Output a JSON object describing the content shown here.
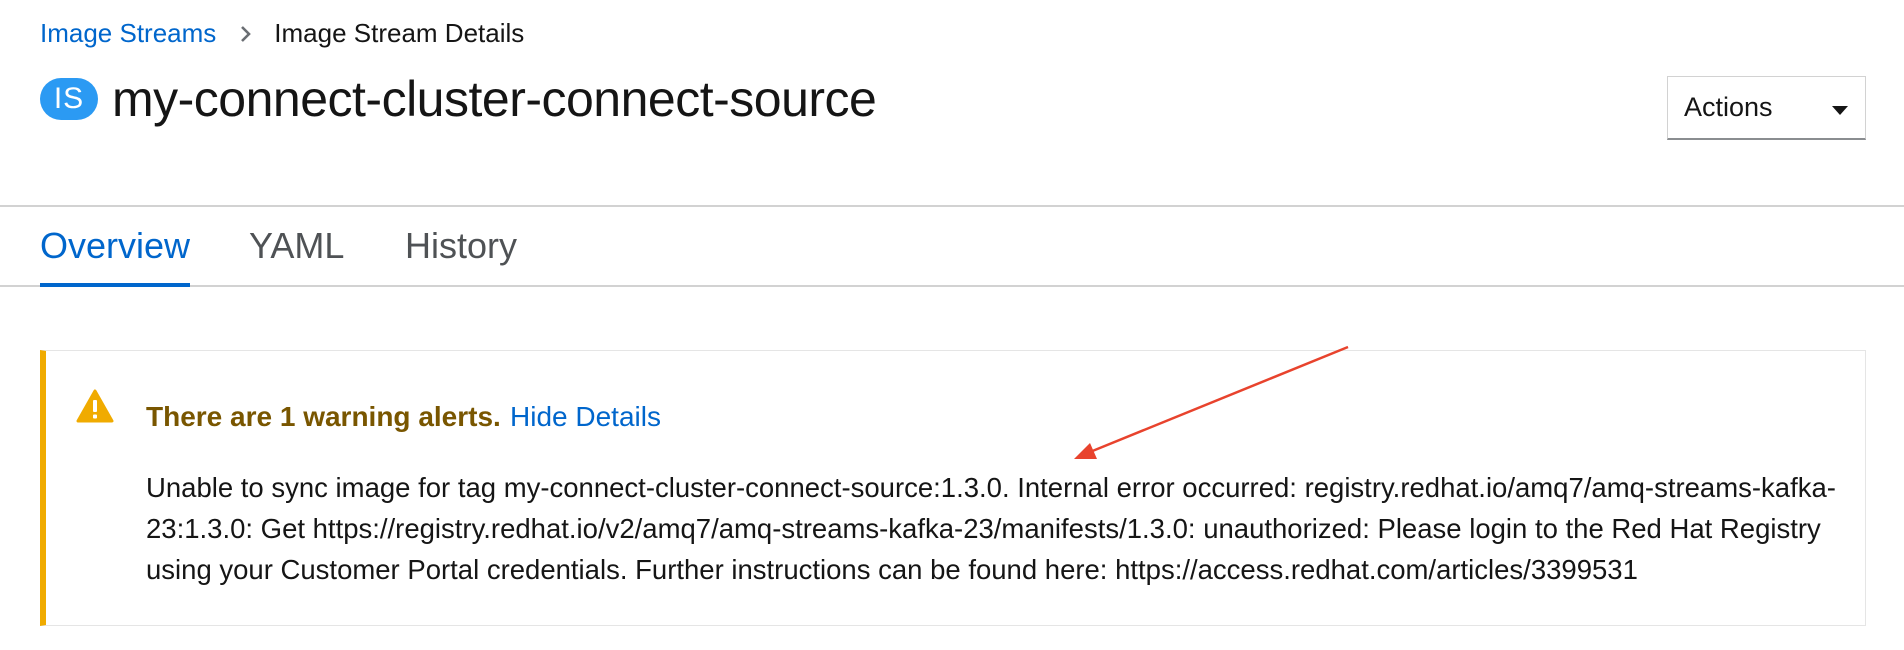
{
  "breadcrumb": {
    "parent": "Image Streams",
    "current": "Image Stream Details"
  },
  "header": {
    "badge": "IS",
    "title": "my-connect-cluster-connect-source",
    "actions_label": "Actions"
  },
  "tabs": [
    {
      "label": "Overview",
      "active": true
    },
    {
      "label": "YAML",
      "active": false
    },
    {
      "label": "History",
      "active": false
    }
  ],
  "alert": {
    "title": "There are 1 warning alerts.",
    "toggle_label": "Hide Details",
    "message": "Unable to sync image for tag my-connect-cluster-connect-source:1.3.0. Internal error occurred: registry.redhat.io/amq7/amq-streams-kafka-23:1.3.0: Get https://registry.redhat.io/v2/amq7/amq-streams-kafka-23/manifests/1.3.0: unauthorized: Please login to the Red Hat Registry using your Customer Portal credentials. Further instructions can be found here: https://access.redhat.com/articles/3399531"
  },
  "colors": {
    "link": "#0066cc",
    "warning_border": "#f0ab00",
    "warning_title": "#795600",
    "badge": "#2b9af3",
    "annotation_arrow": "#e8432d"
  },
  "icons": {
    "breadcrumb_separator": "chevron-right-icon",
    "actions_caret": "caret-down-icon",
    "alert": "warning-triangle-icon"
  }
}
